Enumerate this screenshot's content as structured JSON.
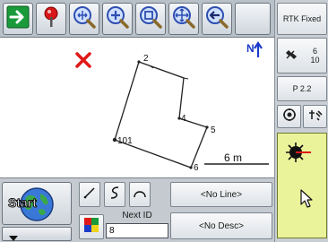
{
  "toolbar": {
    "buttons": [
      {
        "icon": "exit-arrow-icon"
      },
      {
        "icon": "flag-marker-icon"
      },
      {
        "icon": "zoom-extents-icon"
      },
      {
        "icon": "zoom-in-icon"
      },
      {
        "icon": "zoom-window-icon"
      },
      {
        "icon": "pan-icon"
      },
      {
        "icon": "previous-view-icon"
      }
    ]
  },
  "status": {
    "rtk_label": "RTK Fixed",
    "satellites_top": "6",
    "satellites_bottom": "10",
    "pdop_label": "P 2.2"
  },
  "map": {
    "north_label": "N",
    "point_labels": [
      "2",
      "4",
      "5",
      "6",
      "101"
    ],
    "scale_label": "6 m"
  },
  "bottom": {
    "start_label": "Start",
    "line_button": "<No Line>",
    "desc_button": "<No Desc>",
    "next_id_label": "Next ID",
    "next_id_value": "8"
  },
  "colors": {
    "accent_green": "#1a9a3a",
    "marker_red": "#e01818",
    "panel_yellow": "#ebf39a"
  }
}
